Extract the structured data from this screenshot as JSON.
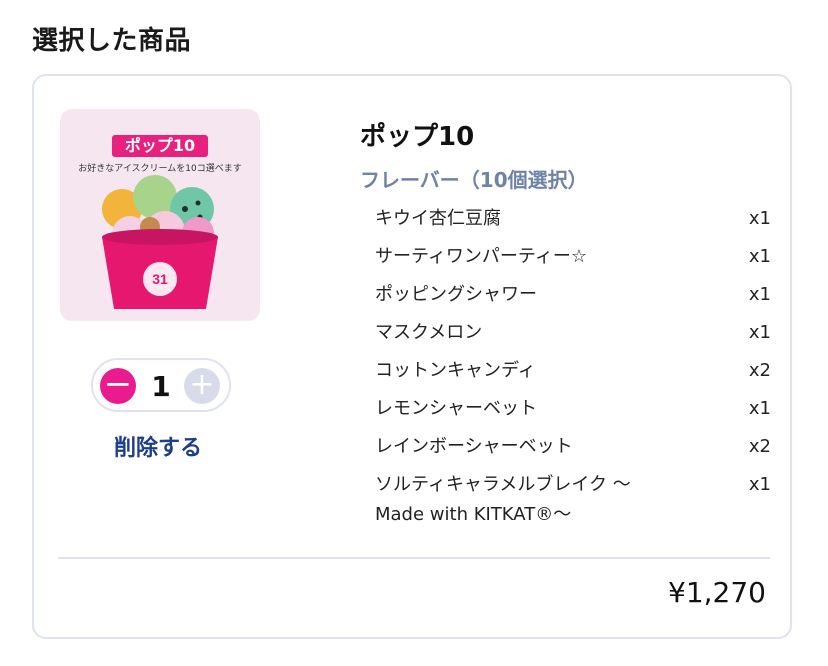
{
  "header": {
    "title": "選択した商品"
  },
  "product": {
    "image_tag": "ポップ10",
    "image_subtitle": "お好きなアイスクリームを10コ選べます",
    "image_logo": "BR baskin robbins",
    "name": "ポップ10",
    "flavor_heading": "フレーバー（10個選択）",
    "flavors": [
      {
        "name": "キウイ杏仁豆腐",
        "count": "x1"
      },
      {
        "name": "サーティワンパーティー☆",
        "count": "x1"
      },
      {
        "name": "ポッピングシャワー",
        "count": "x1"
      },
      {
        "name": "マスクメロン",
        "count": "x1"
      },
      {
        "name": "コットンキャンディ",
        "count": "x2"
      },
      {
        "name": "レモンシャーベット",
        "count": "x1"
      },
      {
        "name": "レインボーシャーベット",
        "count": "x2"
      },
      {
        "name": "ソルティキャラメルブレイク 〜Made with KITKAT®〜",
        "count": "x1"
      }
    ],
    "price": "¥1,270"
  },
  "quantity": {
    "value": "1",
    "minus_icon": "minus-icon",
    "plus_icon": "plus-icon",
    "minus_label": "−",
    "plus_label": "+"
  },
  "actions": {
    "remove_label": "削除する"
  },
  "colors": {
    "accent_pink": "#e91b8e",
    "link_blue": "#1d3f8a",
    "flavor_heading": "#6f83a6",
    "border": "#dfe3ee"
  }
}
